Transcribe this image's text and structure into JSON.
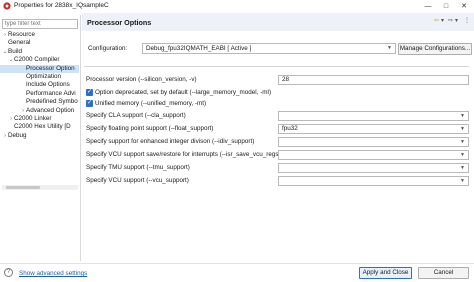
{
  "window": {
    "title": "Properties for 2838x_IQsampleC",
    "minimize": "—",
    "maximize": "□",
    "close": "✕"
  },
  "sidebar": {
    "filter_placeholder": "type filter text",
    "items": [
      {
        "label": "Resource",
        "twisty": "›"
      },
      {
        "label": "General",
        "twisty": ""
      },
      {
        "label": "Build",
        "twisty": "⌄"
      },
      {
        "label": "C2000 Compiler",
        "twisty": "⌄"
      },
      {
        "label": "Processor Option",
        "twisty": ""
      },
      {
        "label": "Optimization",
        "twisty": ""
      },
      {
        "label": "Include Options",
        "twisty": ""
      },
      {
        "label": "Performance Advi",
        "twisty": ""
      },
      {
        "label": "Predefined Symbo",
        "twisty": ""
      },
      {
        "label": "Advanced Option",
        "twisty": "›"
      },
      {
        "label": "C2000 Linker",
        "twisty": "›"
      },
      {
        "label": "C2000 Hex Utility  [D",
        "twisty": ""
      },
      {
        "label": "Debug",
        "twisty": "›"
      }
    ]
  },
  "main": {
    "title": "Processor Options",
    "header_icons": {
      "nav": "⇦",
      "nav_dd": "▾",
      "fwd": "⇨",
      "fwd_dd": "▾",
      "menu": "⋮"
    },
    "config_label": "Configuration:",
    "config_value": "Debug_fpu32IQMATH_EABI  [ Active ]",
    "manage_button": "Manage Configurations...",
    "rows": [
      {
        "kind": "text",
        "label": "Processor version (--silicon_version, -v)",
        "value": "28"
      },
      {
        "kind": "check",
        "label": "Option deprecated, set by default (--large_memory_model, -ml)",
        "checked": true
      },
      {
        "kind": "check",
        "label": "Unified memory (--unified_memory, -mt)",
        "checked": true
      },
      {
        "kind": "select",
        "label": "Specify CLA support (--cla_support)",
        "value": ""
      },
      {
        "kind": "select",
        "label": "Specify floating point support (--float_support)",
        "value": "fpu32"
      },
      {
        "kind": "select",
        "label": "Specify support for enhanced integer divison (--idiv_support)",
        "value": ""
      },
      {
        "kind": "select",
        "label": "Specify VCU support save/restore for interrupts (--isr_save_vcu_regs)",
        "value": ""
      },
      {
        "kind": "select",
        "label": "Specify TMU support (--tmu_support)",
        "value": ""
      },
      {
        "kind": "select",
        "label": "Specify VCU support (--vcu_support)",
        "value": ""
      }
    ]
  },
  "footer": {
    "advanced_link": "Show advanced settings",
    "apply_close": "Apply and Close",
    "cancel": "Cancel",
    "help": "?"
  },
  "colors": {
    "accent": "#2c6fd1",
    "selection": "#cfe3f7",
    "header_bg": "#eef1f7",
    "link": "#1a5fb4"
  }
}
